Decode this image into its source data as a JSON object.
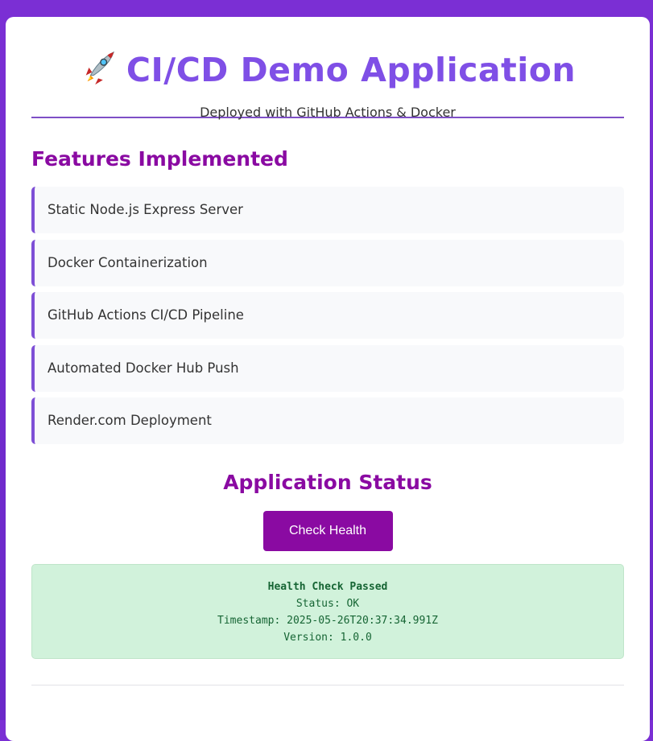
{
  "header": {
    "title": "CI/CD Demo Application",
    "subtitle": "Deployed with GitHub Actions & Docker"
  },
  "icons": {
    "title_icon": "rocket-icon"
  },
  "colors": {
    "accent_purple": "#7f4fe6",
    "heading_magenta": "#8a0aa2",
    "success_bg": "#d1f2db",
    "success_text": "#166534"
  },
  "features": {
    "heading": "Features Implemented",
    "items": [
      "Static Node.js Express Server",
      "Docker Containerization",
      "GitHub Actions CI/CD Pipeline",
      "Automated Docker Hub Push",
      "Render.com Deployment"
    ]
  },
  "status": {
    "heading": "Application Status",
    "button_label": "Check Health",
    "result": {
      "title": "Health Check Passed",
      "status_line": "Status: OK",
      "timestamp_line": "Timestamp: 2025-05-26T20:37:34.991Z",
      "version_line": "Version: 1.0.0"
    }
  }
}
